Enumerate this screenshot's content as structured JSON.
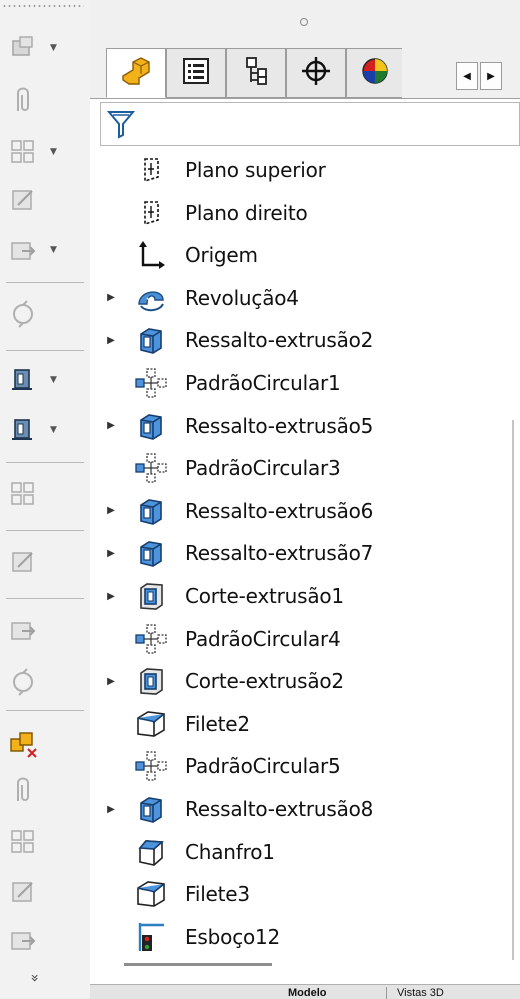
{
  "toolbar": {
    "buttons": [
      {
        "name": "insert-part-icon",
        "dropdown": true
      },
      {
        "name": "paperclip-icon",
        "dropdown": false
      },
      {
        "name": "pattern-grid-icon",
        "dropdown": true
      },
      {
        "name": "edit-component-icon",
        "dropdown": false
      },
      {
        "name": "move-component-icon",
        "dropdown": true
      },
      {
        "name": "rotate-component-icon",
        "dropdown": false
      },
      {
        "name": "exploded-view-icon",
        "dropdown": true
      },
      {
        "name": "reference-plane-icon",
        "dropdown": true
      },
      {
        "name": "gear-settings-icon",
        "dropdown": false
      },
      {
        "name": "bill-of-materials-icon",
        "dropdown": false
      },
      {
        "name": "mate-icon",
        "dropdown": false
      },
      {
        "name": "smart-mate-icon",
        "dropdown": false
      },
      {
        "name": "interference-detection-icon",
        "dropdown": false
      },
      {
        "name": "section-view-icon",
        "dropdown": false
      },
      {
        "name": "assembly-icon",
        "dropdown": false
      },
      {
        "name": "new-assembly-icon",
        "dropdown": false
      },
      {
        "name": "view-orientation-icon",
        "dropdown": false
      }
    ],
    "more_glyph": "»"
  },
  "panel": {
    "tabs": [
      {
        "name": "tab-feature-manager",
        "icon": "part-icon",
        "active": true
      },
      {
        "name": "tab-property-manager",
        "icon": "list-icon",
        "active": false
      },
      {
        "name": "tab-configuration-manager",
        "icon": "configuration-icon",
        "active": false
      },
      {
        "name": "tab-dimxpert-manager",
        "icon": "crosshair-icon",
        "active": false
      },
      {
        "name": "tab-display-manager",
        "icon": "color-pie-icon",
        "active": false
      }
    ],
    "filter_icon": "filter-icon",
    "tree": [
      {
        "label": "Plano superior",
        "icon": "plane-icon",
        "expandable": false
      },
      {
        "label": "Plano direito",
        "icon": "plane-icon",
        "expandable": false
      },
      {
        "label": "Origem",
        "icon": "origin-icon",
        "expandable": false
      },
      {
        "label": "Revolução4",
        "icon": "revolve-icon",
        "expandable": true
      },
      {
        "label": "Ressalto-extrusão2",
        "icon": "boss-extrude-icon",
        "expandable": true
      },
      {
        "label": "PadrãoCircular1",
        "icon": "circular-pattern-icon",
        "expandable": false
      },
      {
        "label": "Ressalto-extrusão5",
        "icon": "boss-extrude-icon",
        "expandable": true
      },
      {
        "label": "PadrãoCircular3",
        "icon": "circular-pattern-icon",
        "expandable": false
      },
      {
        "label": "Ressalto-extrusão6",
        "icon": "boss-extrude-icon",
        "expandable": true
      },
      {
        "label": "Ressalto-extrusão7",
        "icon": "boss-extrude-icon",
        "expandable": true
      },
      {
        "label": "Corte-extrusão1",
        "icon": "cut-extrude-icon",
        "expandable": true
      },
      {
        "label": "PadrãoCircular4",
        "icon": "circular-pattern-icon",
        "expandable": false
      },
      {
        "label": "Corte-extrusão2",
        "icon": "cut-extrude-icon",
        "expandable": true
      },
      {
        "label": "Filete2",
        "icon": "fillet-icon",
        "expandable": false
      },
      {
        "label": "PadrãoCircular5",
        "icon": "circular-pattern-icon",
        "expandable": false
      },
      {
        "label": "Ressalto-extrusão8",
        "icon": "boss-extrude-icon",
        "expandable": true
      },
      {
        "label": "Chanfro1",
        "icon": "chamfer-icon",
        "expandable": false
      },
      {
        "label": "Filete3",
        "icon": "fillet-icon",
        "expandable": false
      },
      {
        "label": "Esboço12",
        "icon": "sketch-icon",
        "expandable": false
      }
    ],
    "expander_glyph": "▶"
  },
  "bottom_tabs": {
    "model": "Modelo",
    "views3d": "Vistas 3D"
  },
  "colors": {
    "accent_blue": "#2d7fc1",
    "icon_gray": "#b0b0b0",
    "tab_border": "#9c9c9c"
  }
}
